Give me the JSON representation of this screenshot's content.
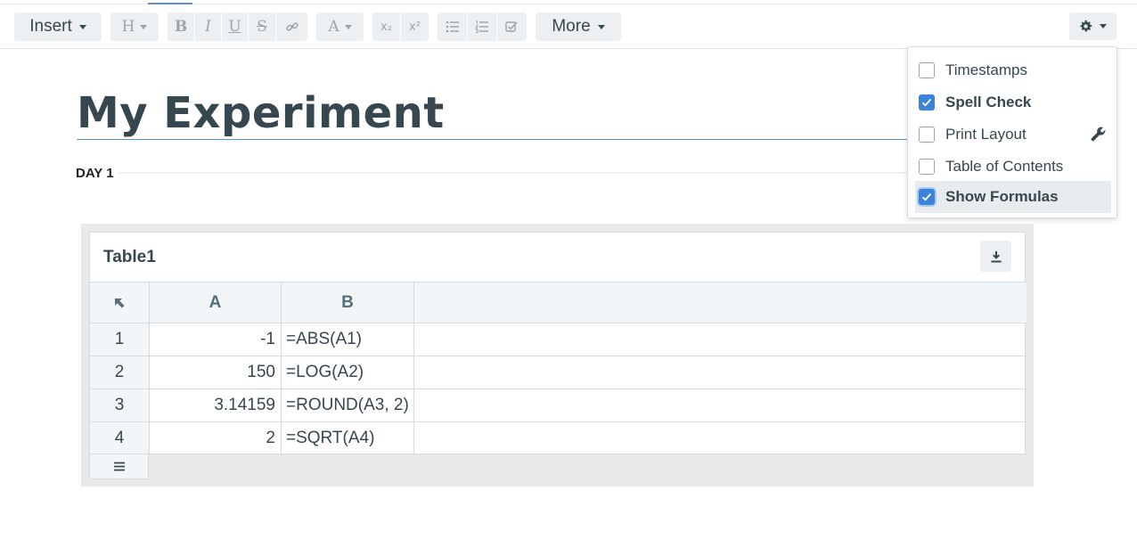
{
  "toolbar": {
    "insert_label": "Insert",
    "more_label": "More",
    "heading_glyph": "H",
    "bold_glyph": "B",
    "italic_glyph": "I",
    "underline_glyph": "U",
    "strike_glyph": "S",
    "font_color_glyph": "A",
    "subscript_glyph": "x₂",
    "superscript_glyph": "x²"
  },
  "document": {
    "title": "My Experiment",
    "section": "DAY 1"
  },
  "table": {
    "name": "Table1",
    "columns": [
      "A",
      "B"
    ],
    "rows": [
      {
        "index": "1",
        "a": "-1",
        "b": "=ABS(A1)"
      },
      {
        "index": "2",
        "a": "150",
        "b": "=LOG(A2)"
      },
      {
        "index": "3",
        "a": "3.14159",
        "b": "=ROUND(A3, 2)"
      },
      {
        "index": "4",
        "a": "2",
        "b": "=SQRT(A4)"
      }
    ]
  },
  "settings_menu": {
    "items": [
      {
        "label": "Timestamps",
        "checked": false
      },
      {
        "label": "Spell Check",
        "checked": true
      },
      {
        "label": "Print Layout",
        "checked": false
      },
      {
        "label": "Table of Contents",
        "checked": false
      },
      {
        "label": "Show Formulas",
        "checked": true
      }
    ]
  },
  "colors": {
    "accent": "#3b82d8",
    "toolbar_button": "#edf0f2",
    "text": "#37474f"
  },
  "icons": [
    "chevron-down-icon",
    "link-icon",
    "bullet-list-icon",
    "numbered-list-icon",
    "checklist-icon",
    "download-icon",
    "select-all-icon",
    "menu-icon",
    "gear-icon",
    "wrench-icon",
    "checkmark-icon"
  ]
}
